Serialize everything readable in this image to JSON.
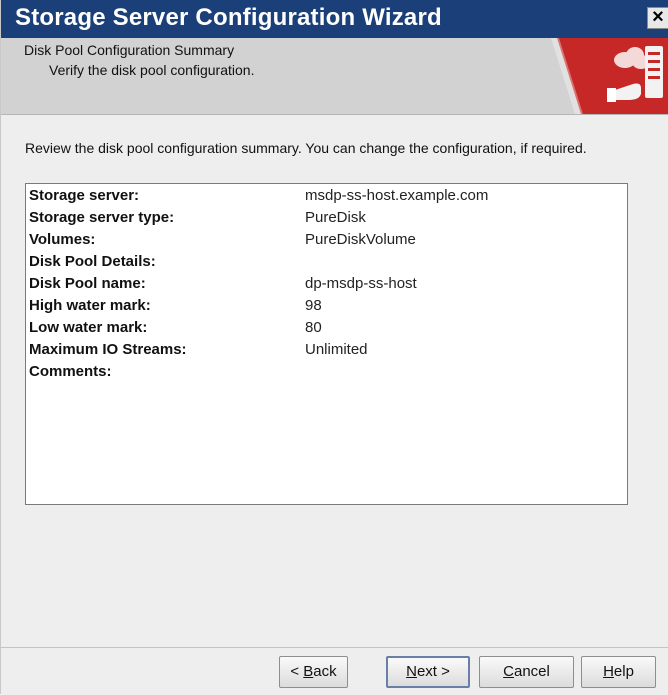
{
  "window": {
    "title": "Storage Server Configuration Wizard",
    "close_label": "×"
  },
  "banner": {
    "title": "Disk Pool Configuration Summary",
    "subtitle": "Verify the disk pool configuration."
  },
  "instructions": "Review the disk pool configuration summary. You can change the configuration, if required.",
  "summary": {
    "rows": [
      {
        "label": "Storage server:",
        "value": "msdp-ss-host.example.com"
      },
      {
        "label": "Storage server type:",
        "value": "PureDisk"
      },
      {
        "label": "Volumes:",
        "value": "PureDiskVolume"
      },
      {
        "label": "Disk Pool Details:",
        "value": ""
      },
      {
        "label": "Disk Pool name:",
        "value": "dp-msdp-ss-host"
      },
      {
        "label": "High water mark:",
        "value": "98"
      },
      {
        "label": "Low water mark:",
        "value": "80"
      },
      {
        "label": "Maximum IO Streams:",
        "value": "Unlimited"
      },
      {
        "label": "Comments:",
        "value": ""
      }
    ]
  },
  "buttons": {
    "back": {
      "prefix": "< ",
      "mnemonic": "B",
      "rest": "ack"
    },
    "next": {
      "prefix": "",
      "mnemonic": "N",
      "rest": "ext >"
    },
    "cancel": {
      "prefix": "",
      "mnemonic": "C",
      "rest": "ancel"
    },
    "help": {
      "prefix": "",
      "mnemonic": "H",
      "rest": "elp"
    }
  },
  "colors": {
    "titlebar": "#1a3f79",
    "banner_accent": "#c62828"
  },
  "icons": {
    "banner": "server-cloud-hand-icon"
  }
}
